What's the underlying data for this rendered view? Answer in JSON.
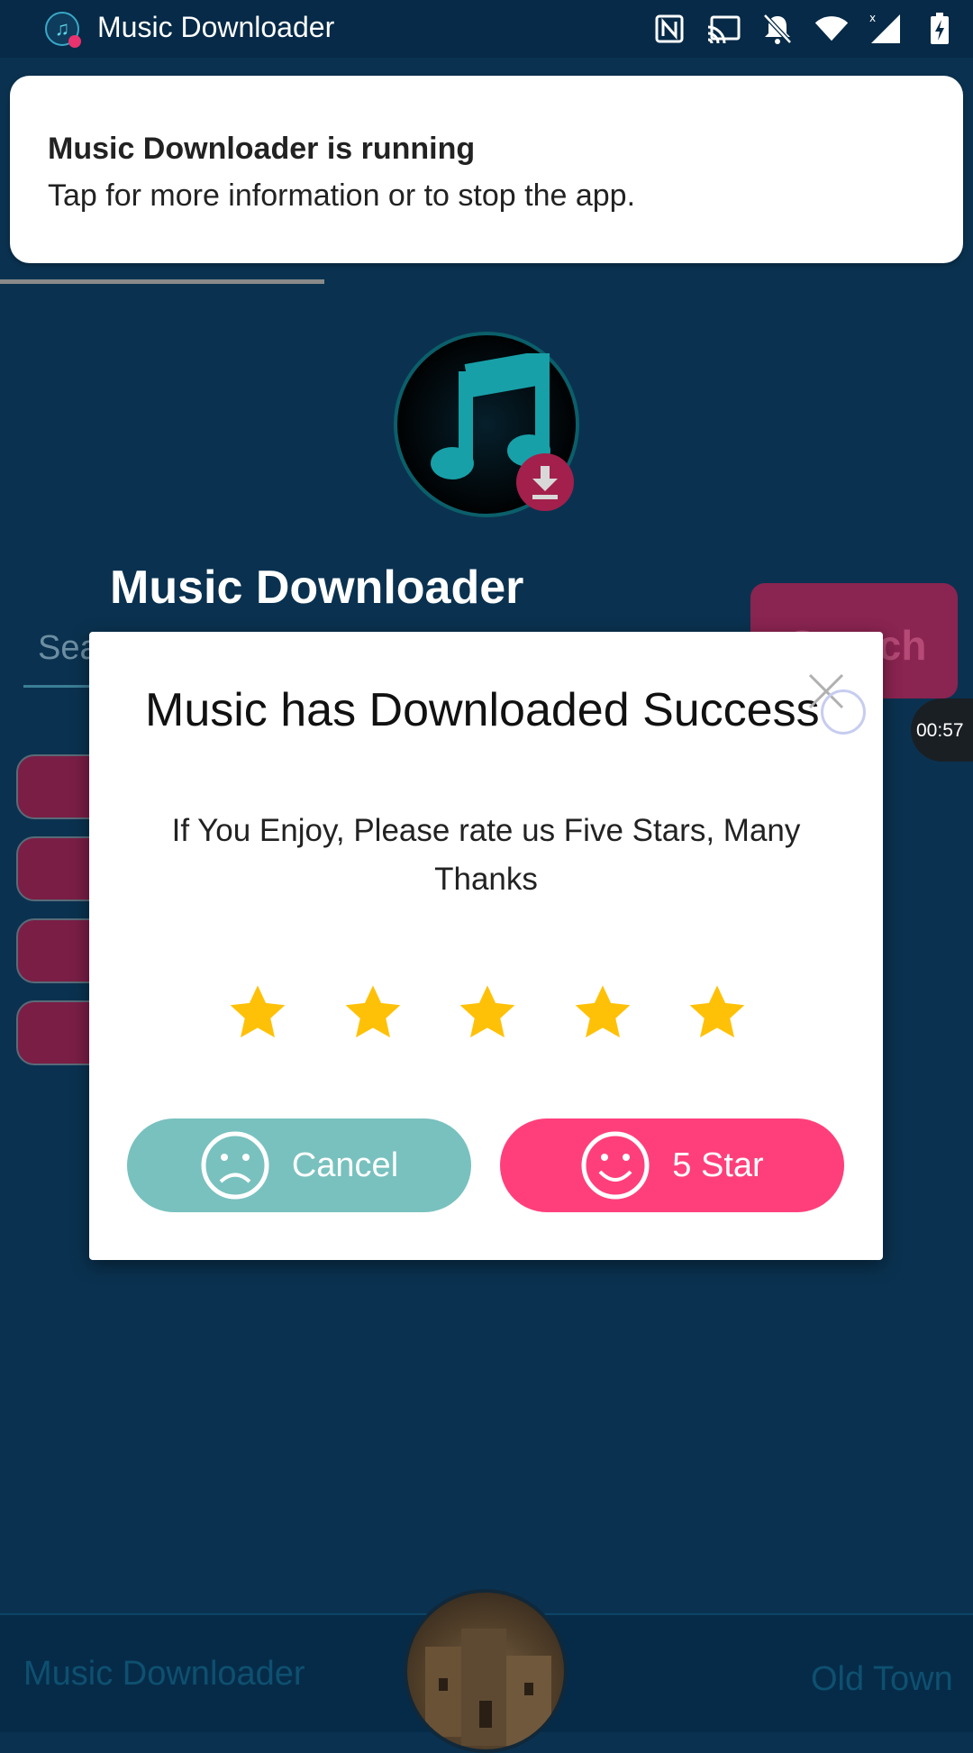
{
  "status_bar": {
    "app_title": "Music Downloader",
    "icons": [
      "nfc-icon",
      "cast-icon",
      "notifications-off-icon",
      "wifi-icon",
      "cell-signal-icon",
      "battery-charging-icon"
    ]
  },
  "notification": {
    "title": "Music Downloader is running",
    "text": "Tap for more information or to stop the app."
  },
  "app": {
    "title": "Music Downloader",
    "search_placeholder": "Sea",
    "search_button": "Search",
    "timer": "00:57"
  },
  "dialog": {
    "title": "Music has Downloaded Success",
    "message": "If You Enjoy, Please rate us Five Stars, Many Thanks",
    "rating": 5,
    "cancel_label": "Cancel",
    "five_star_label": "5 Star"
  },
  "bottom_bar": {
    "left_label": "Music Downloader",
    "right_label": "Old Town"
  },
  "colors": {
    "background": "#0a3250",
    "star": "#ffc107",
    "cancel": "#78c1be",
    "five_star": "#ff3f7b"
  }
}
